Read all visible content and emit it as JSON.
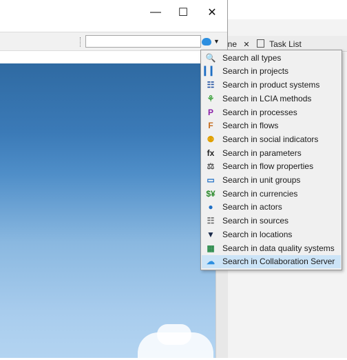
{
  "window": {
    "minimize_glyph": "—",
    "maximize_glyph": "☐",
    "close_glyph": "✕"
  },
  "search": {
    "placeholder": "",
    "value": ""
  },
  "bg_tabs": {
    "tab1_label": "ine",
    "tab1_close": "✕",
    "tab2_label": "Task List"
  },
  "menu": {
    "items": [
      {
        "label": "Search all types",
        "icon": "search-icon",
        "glyph": "🔍",
        "color": "#333333"
      },
      {
        "label": "Search in projects",
        "icon": "projects-icon",
        "glyph": "▎▎",
        "color": "#1f6fc4"
      },
      {
        "label": "Search in product systems",
        "icon": "product-systems-icon",
        "glyph": "☷",
        "color": "#1f4fa0"
      },
      {
        "label": "Search in LCIA methods",
        "icon": "lcia-methods-icon",
        "glyph": "⚘",
        "color": "#3aa13a"
      },
      {
        "label": "Search in processes",
        "icon": "processes-icon",
        "glyph": "P",
        "color": "#8a1fa8"
      },
      {
        "label": "Search in flows",
        "icon": "flows-icon",
        "glyph": "F",
        "color": "#c56a1a"
      },
      {
        "label": "Search in social indicators",
        "icon": "social-indicators-icon",
        "glyph": "⚉",
        "color": "#e0a000"
      },
      {
        "label": "Search in parameters",
        "icon": "parameters-icon",
        "glyph": "fx",
        "color": "#222222"
      },
      {
        "label": "Search in flow properties",
        "icon": "flow-properties-icon",
        "glyph": "⚖",
        "color": "#555555"
      },
      {
        "label": "Search in unit groups",
        "icon": "unit-groups-icon",
        "glyph": "▭",
        "color": "#1f6fc4"
      },
      {
        "label": "Search in currencies",
        "icon": "currencies-icon",
        "glyph": "$¥",
        "color": "#2a8a2a"
      },
      {
        "label": "Search in actors",
        "icon": "actors-icon",
        "glyph": "●",
        "color": "#1f6fc4"
      },
      {
        "label": "Search in sources",
        "icon": "sources-icon",
        "glyph": "☷",
        "color": "#666666"
      },
      {
        "label": "Search in locations",
        "icon": "locations-icon",
        "glyph": "▼",
        "color": "#1a2a4a"
      },
      {
        "label": "Search in data quality systems",
        "icon": "data-quality-systems-icon",
        "glyph": "▦",
        "color": "#2a8a4a"
      },
      {
        "label": "Search in Collaboration Server",
        "icon": "collaboration-server-icon",
        "glyph": "☁",
        "color": "#2d8fe0",
        "selected": true
      }
    ]
  }
}
